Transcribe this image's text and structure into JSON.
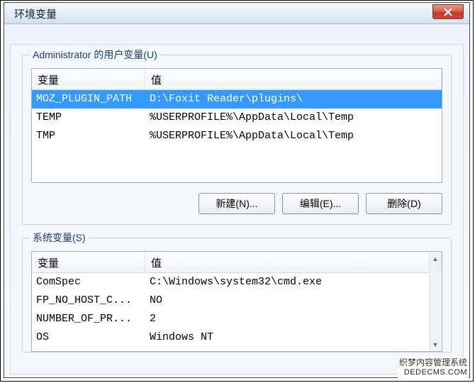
{
  "window": {
    "title": "环境变量"
  },
  "user_vars": {
    "legend": "Administrator 的用户变量(U)",
    "columns": {
      "var": "变量",
      "val": "值"
    },
    "rows": [
      {
        "var": "MOZ_PLUGIN_PATH",
        "val": "D:\\Foxit Reader\\plugins\\",
        "selected": true
      },
      {
        "var": "TEMP",
        "val": "%USERPROFILE%\\AppData\\Local\\Temp",
        "selected": false
      },
      {
        "var": "TMP",
        "val": "%USERPROFILE%\\AppData\\Local\\Temp",
        "selected": false
      }
    ],
    "buttons": {
      "new": "新建(N)...",
      "edit": "编辑(E)...",
      "delete": "删除(D)"
    }
  },
  "sys_vars": {
    "legend": "系统变量(S)",
    "columns": {
      "var": "变量",
      "val": "值"
    },
    "rows": [
      {
        "var": "ComSpec",
        "val": "C:\\Windows\\system32\\cmd.exe"
      },
      {
        "var": "FP_NO_HOST_C...",
        "val": "NO"
      },
      {
        "var": "NUMBER_OF_PR...",
        "val": "2"
      },
      {
        "var": "OS",
        "val": "Windows NT"
      }
    ]
  },
  "watermark": {
    "zh": "织梦内容管理系统",
    "en": "DEDECMS.COM"
  }
}
